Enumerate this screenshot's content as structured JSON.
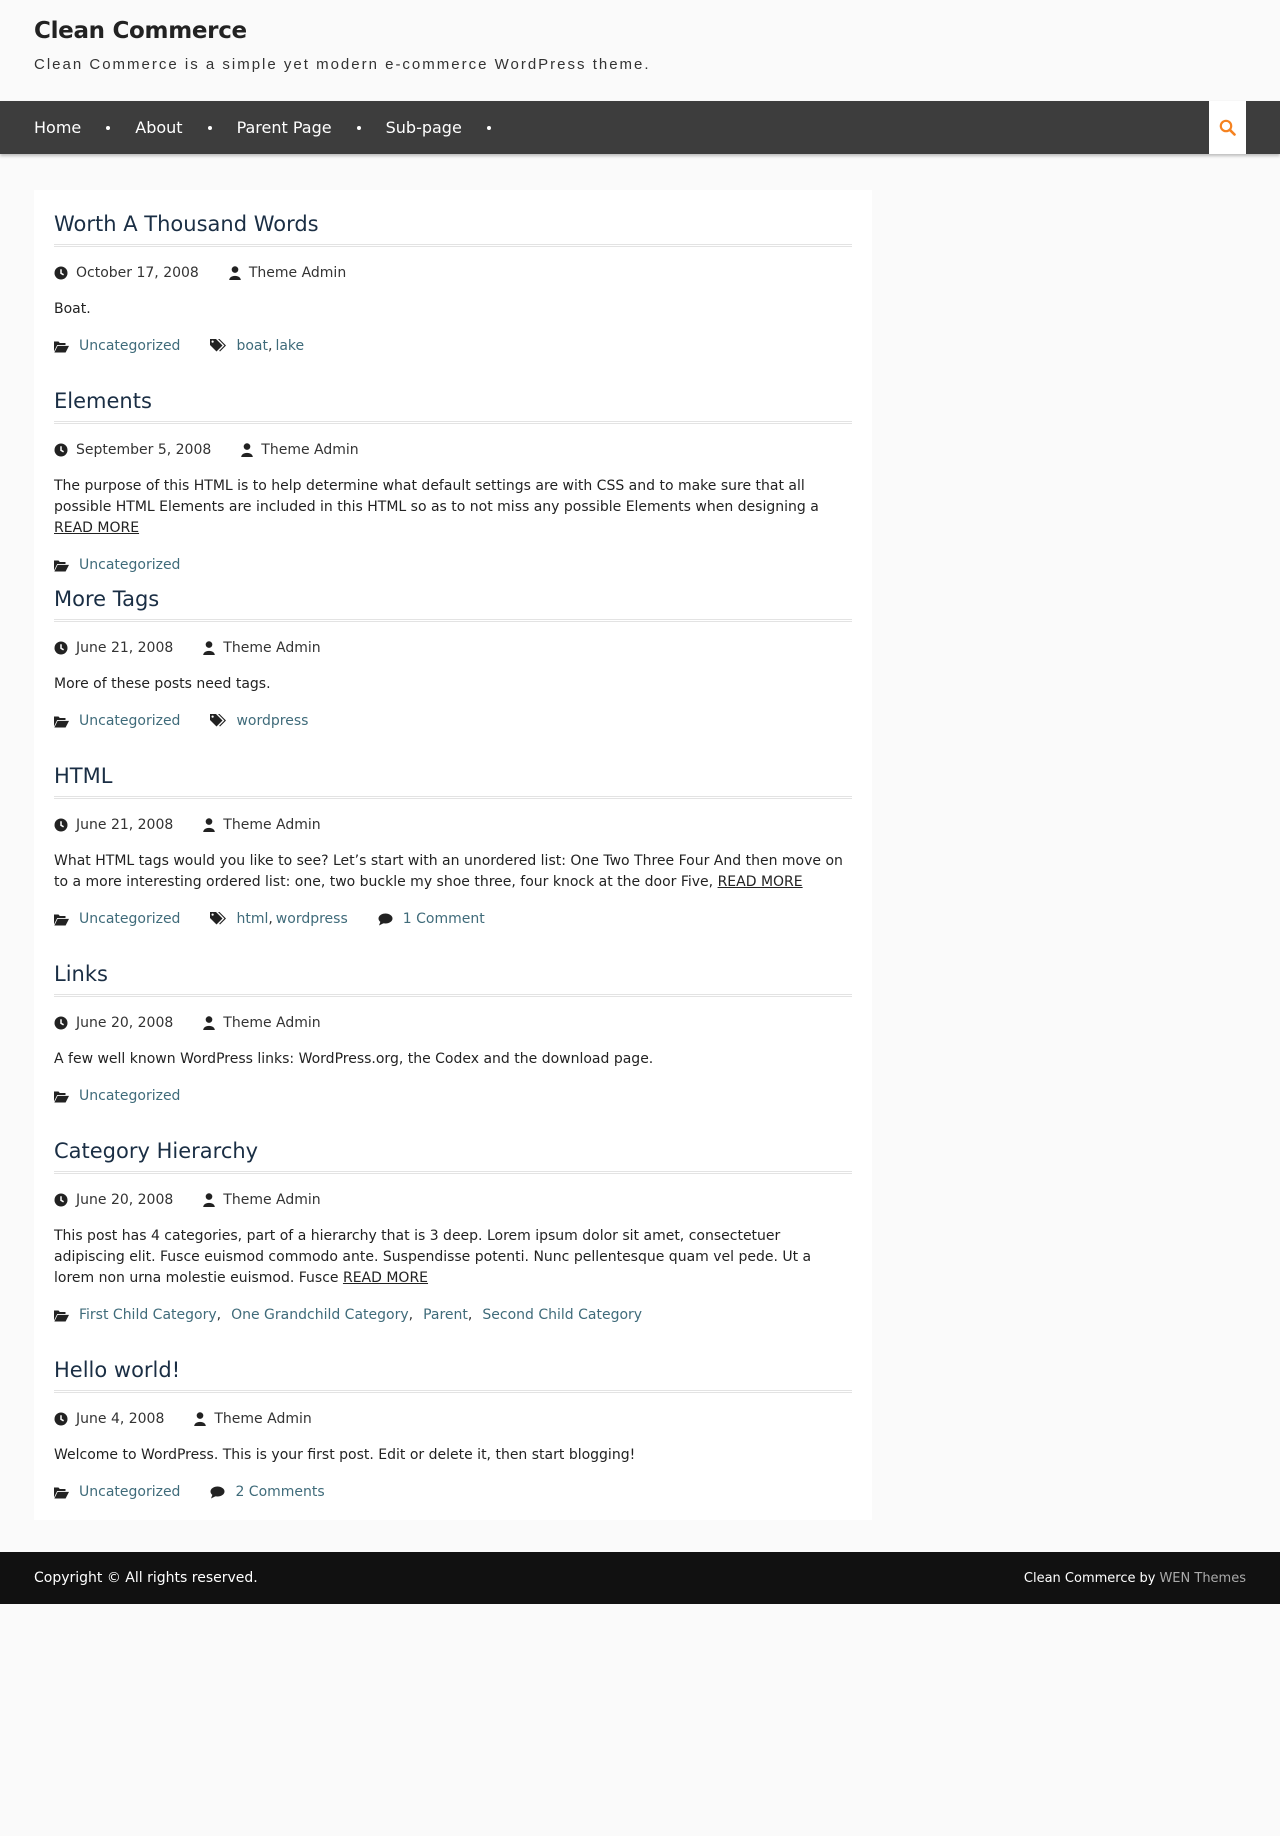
{
  "header": {
    "site_title": "Clean Commerce",
    "tagline": "Clean Commerce is a simple yet modern e-commerce WordPress theme."
  },
  "nav": {
    "items": [
      {
        "label": "Home"
      },
      {
        "label": "About"
      },
      {
        "label": "Parent Page"
      },
      {
        "label": "Sub-page"
      }
    ],
    "search_icon": "search-icon"
  },
  "posts": [
    {
      "title": "Worth A Thousand Words",
      "date": "October 17, 2008",
      "author": "Theme Admin",
      "excerpt": "Boat.",
      "read_more": "",
      "categories": [
        "Uncategorized"
      ],
      "tags": [
        "boat",
        "lake"
      ],
      "comments": ""
    },
    {
      "title": "Elements",
      "date": "September 5, 2008",
      "author": "Theme Admin",
      "excerpt": "The purpose of this HTML is to help determine what default settings are with CSS and to make sure that all possible HTML Elements are included in this HTML so as to not miss any possible Elements when designing a ",
      "read_more": "READ MORE",
      "categories": [
        "Uncategorized"
      ],
      "tags": [],
      "comments": ""
    },
    {
      "title": "More Tags",
      "date": "June 21, 2008",
      "author": "Theme Admin",
      "excerpt": "More of these posts need tags.",
      "read_more": "",
      "categories": [
        "Uncategorized"
      ],
      "tags": [
        "wordpress"
      ],
      "comments": ""
    },
    {
      "title": "HTML",
      "date": "June 21, 2008",
      "author": "Theme Admin",
      "excerpt": "What HTML tags would you like to see? Let’s start with an unordered list: One Two Three Four And then move on to a more interesting ordered list: one, two buckle my shoe three, four knock at the door Five, ",
      "read_more": "READ MORE",
      "categories": [
        "Uncategorized"
      ],
      "tags": [
        "html",
        "wordpress"
      ],
      "comments": "1 Comment"
    },
    {
      "title": "Links",
      "date": "June 20, 2008",
      "author": "Theme Admin",
      "excerpt": "A few well known WordPress links: WordPress.org, the Codex and the download page.",
      "read_more": "",
      "categories": [
        "Uncategorized"
      ],
      "tags": [],
      "comments": ""
    },
    {
      "title": "Category Hierarchy",
      "date": "June 20, 2008",
      "author": "Theme Admin",
      "excerpt": "This post has 4 categories, part of a hierarchy that is 3 deep. Lorem ipsum dolor sit amet, consectetuer adipiscing elit. Fusce euismod commodo ante. Suspendisse potenti. Nunc pellentesque quam vel pede. Ut a lorem non urna molestie euismod. Fusce ",
      "read_more": "READ MORE",
      "categories": [
        "First Child Category",
        "One Grandchild Category",
        "Parent",
        "Second Child Category"
      ],
      "tags": [],
      "comments": ""
    },
    {
      "title": "Hello world!",
      "date": "June 4, 2008",
      "author": "Theme Admin",
      "excerpt": "Welcome to WordPress. This is your first post. Edit or delete it, then start blogging!",
      "read_more": "",
      "categories": [
        "Uncategorized"
      ],
      "tags": [],
      "comments": "2 Comments"
    }
  ],
  "footer": {
    "copyright": "Copyright © All rights reserved.",
    "theme_name": "Clean Commerce",
    "by": "by",
    "author_link": "WEN Themes"
  },
  "colors": {
    "nav_bg": "#3d3d3d",
    "search_accent": "#f58220",
    "link": "#3f6b7a",
    "title": "#1a2e44",
    "footer_bg": "#111111"
  }
}
